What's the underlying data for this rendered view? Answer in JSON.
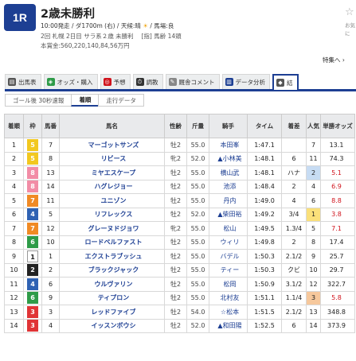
{
  "race": {
    "badge": "1R",
    "title": "2歳未勝利",
    "info1_pre": "10:00発走 / ダ1700m (右) / 天候:晴",
    "info1_sun": "☀",
    "info1_post": "/ 馬場:良",
    "info2": "2回 札幌 2日目 サラ系２歳 未勝利　 [指] 馬齢 14頭",
    "info3": "本賞金:560,220,140,84,56万円"
  },
  "fav": {
    "icon": "☆",
    "label": "お気に"
  },
  "tokushu": "特集へ ›",
  "tabs": [
    {
      "label": "出馬表",
      "icon": "▤",
      "color": "#555"
    },
    {
      "label": "オッズ・購入",
      "icon": "◈",
      "color": "#2e9b48"
    },
    {
      "label": "予想",
      "icon": "◎",
      "color": "#d0131c"
    },
    {
      "label": "調教",
      "icon": "⏱",
      "color": "#333"
    },
    {
      "label": "厩舎コメント",
      "icon": "✎",
      "color": "#888"
    },
    {
      "label": "データ分析",
      "icon": "▥",
      "color": "#1d3f93"
    },
    {
      "label": "結",
      "icon": "◆",
      "color": "#555"
    }
  ],
  "subtabs": [
    "ゴール後 30秒速報",
    "着順",
    "走行データ"
  ],
  "headers": [
    "着順",
    "枠",
    "馬番",
    "馬名",
    "性齢",
    "斤量",
    "騎手",
    "タイム",
    "着差",
    "人気",
    "単勝オッズ"
  ],
  "rows": [
    {
      "pos": "1",
      "waku": "5",
      "num": "7",
      "name": "マーゴットサンズ",
      "sex": "牡2",
      "kin": "55.0",
      "jockey": "本田峯",
      "time": "1:47.1",
      "diff": "",
      "pop": "7",
      "odds": "13.1"
    },
    {
      "pos": "2",
      "waku": "5",
      "num": "8",
      "name": "リビース",
      "sex": "牝2",
      "kin": "52.0",
      "jockey": "▲小林美",
      "time": "1:48.1",
      "diff": "6",
      "pop": "11",
      "odds": "74.3"
    },
    {
      "pos": "3",
      "waku": "8",
      "num": "13",
      "name": "ミヤエスケープ",
      "sex": "牡2",
      "kin": "55.0",
      "jockey": "横山武",
      "time": "1:48.1",
      "diff": "ハナ",
      "pop": "2",
      "odds": "5.1"
    },
    {
      "pos": "4",
      "waku": "8",
      "num": "14",
      "name": "ハグレジョー",
      "sex": "牡2",
      "kin": "55.0",
      "jockey": "池添",
      "time": "1:48.4",
      "diff": "2",
      "pop": "4",
      "odds": "6.9"
    },
    {
      "pos": "5",
      "waku": "7",
      "num": "11",
      "name": "ユニゾン",
      "sex": "牡2",
      "kin": "55.0",
      "jockey": "丹内",
      "time": "1:49.0",
      "diff": "4",
      "pop": "6",
      "odds": "8.8"
    },
    {
      "pos": "6",
      "waku": "4",
      "num": "5",
      "name": "リフレックス",
      "sex": "牡2",
      "kin": "52.0",
      "jockey": "▲柴田裕",
      "time": "1:49.2",
      "diff": "3/4",
      "pop": "1",
      "odds": "3.8"
    },
    {
      "pos": "7",
      "waku": "7",
      "num": "12",
      "name": "グレーヌドジョワ",
      "sex": "牝2",
      "kin": "55.0",
      "jockey": "松山",
      "time": "1:49.5",
      "diff": "1.3/4",
      "pop": "5",
      "odds": "7.1"
    },
    {
      "pos": "8",
      "waku": "6",
      "num": "10",
      "name": "ロードベルファスト",
      "sex": "牡2",
      "kin": "55.0",
      "jockey": "ウィリ",
      "time": "1:49.8",
      "diff": "2",
      "pop": "8",
      "odds": "17.4"
    },
    {
      "pos": "9",
      "waku": "1",
      "num": "1",
      "name": "エクストラブッシュ",
      "sex": "牡2",
      "kin": "55.0",
      "jockey": "バデル",
      "time": "1:50.3",
      "diff": "2.1/2",
      "pop": "9",
      "odds": "25.7"
    },
    {
      "pos": "10",
      "waku": "2",
      "num": "2",
      "name": "ブラックジャック",
      "sex": "牡2",
      "kin": "55.0",
      "jockey": "ティー",
      "time": "1:50.3",
      "diff": "クビ",
      "pop": "10",
      "odds": "29.7"
    },
    {
      "pos": "11",
      "waku": "4",
      "num": "6",
      "name": "ウルヴァリン",
      "sex": "牡2",
      "kin": "55.0",
      "jockey": "松岡",
      "time": "1:50.9",
      "diff": "3.1/2",
      "pop": "12",
      "odds": "322.7"
    },
    {
      "pos": "12",
      "waku": "6",
      "num": "9",
      "name": "ティプロン",
      "sex": "牡2",
      "kin": "55.0",
      "jockey": "北村友",
      "time": "1:51.1",
      "diff": "1.1/4",
      "pop": "3",
      "odds": "5.8"
    },
    {
      "pos": "13",
      "waku": "3",
      "num": "3",
      "name": "レッドファイブ",
      "sex": "牡2",
      "kin": "54.0",
      "jockey": "☆松本",
      "time": "1:51.5",
      "diff": "2.1/2",
      "pop": "13",
      "odds": "348.8"
    },
    {
      "pos": "14",
      "waku": "3",
      "num": "4",
      "name": "イッスンボウシ",
      "sex": "牡2",
      "kin": "52.0",
      "jockey": "▲和田陽",
      "time": "1:52.5",
      "diff": "6",
      "pop": "14",
      "odds": "373.9"
    }
  ],
  "colors": {
    "accent": "#1d3f93",
    "odds_hot": "#d0131c"
  }
}
